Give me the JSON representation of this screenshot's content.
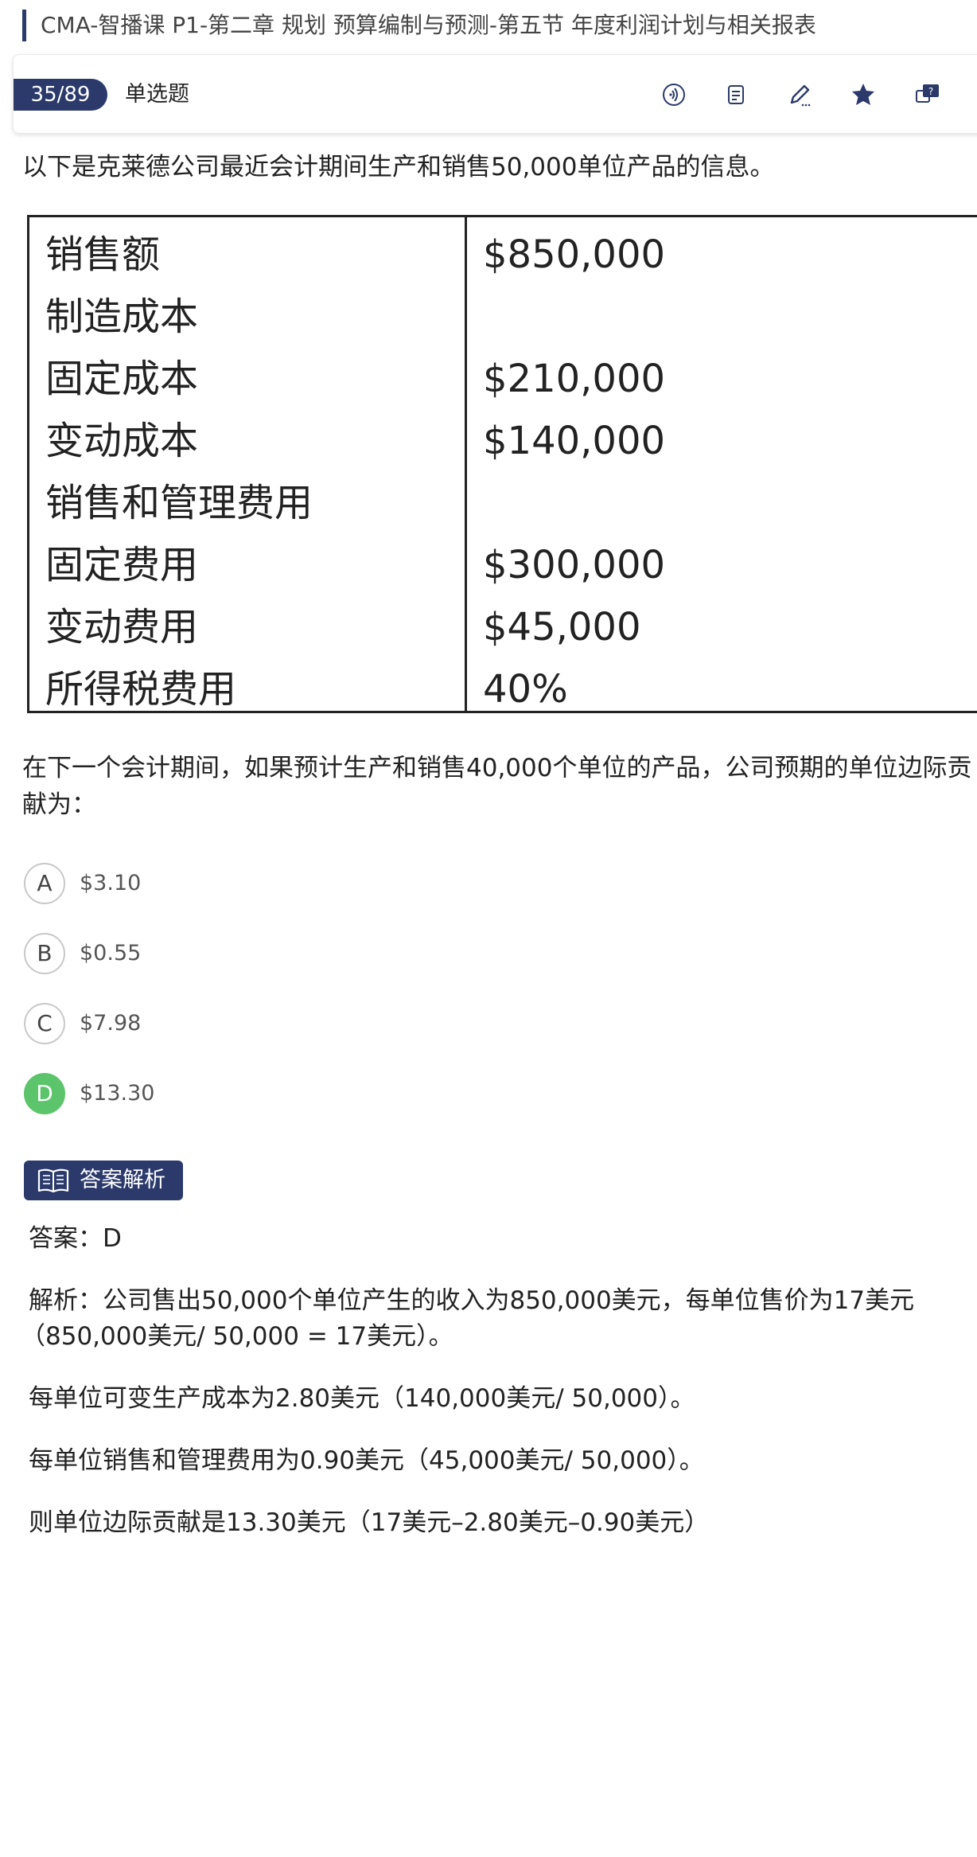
{
  "course_title": "CMA-智播课 P1-第二章 规划 预算编制与预测-第五节 年度利润计划与相关报表",
  "toolbar": {
    "counter": "35/89",
    "question_type": "单选题",
    "icons": [
      "audio-icon",
      "notes-icon",
      "edit-icon",
      "favorite-icon",
      "question-feedback-icon"
    ]
  },
  "question": {
    "intro": "以下是克莱德公司最近会计期间生产和销售50,000单位产品的信息。",
    "table": {
      "rows": [
        {
          "label": "销售额",
          "value": "$850,000"
        },
        {
          "label": "制造成本",
          "value": ""
        },
        {
          "label": "固定成本",
          "value": "$210,000"
        },
        {
          "label": "变动成本",
          "value": "$140,000"
        },
        {
          "label": "销售和管理费用",
          "value": ""
        },
        {
          "label": "固定费用",
          "value": "$300,000"
        },
        {
          "label": "变动费用",
          "value": "$45,000"
        },
        {
          "label": "所得税费用",
          "value": "40%"
        }
      ]
    },
    "stem_line1": "在下一个会计期间，如果预计生产和销售40,000个单位的产品，公司预期的单位边际贡",
    "stem_line2": "献为：",
    "options": [
      {
        "letter": "A",
        "text": "$3.10"
      },
      {
        "letter": "B",
        "text": "$0.55"
      },
      {
        "letter": "C",
        "text": "$7.98"
      },
      {
        "letter": "D",
        "text": "$13.30"
      }
    ],
    "selected_option": "D",
    "correct_color": "#5cc46b"
  },
  "analysis": {
    "badge_label": "答案解析",
    "answer": "答案：D",
    "para1_line1": "解析：公司售出50,000个单位产生的收入为850,000美元，每单位售价为17美元",
    "para1_line2": "（850,000美元/ 50,000 = 17美元）。",
    "para2": "每单位可变生产成本为2.80美元（140,000美元/ 50,000）。",
    "para3": "每单位销售和管理费用为0.90美元（45,000美元/ 50,000）。",
    "para4": "则单位边际贡献是13.30美元（17美元–2.80美元–0.90美元）"
  },
  "colors": {
    "primary": "#2b3a6b",
    "correct": "#5cc46b"
  }
}
